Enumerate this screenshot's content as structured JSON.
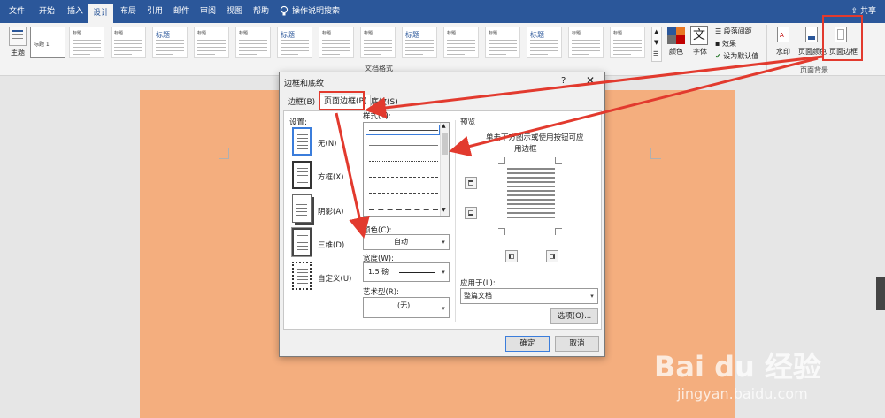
{
  "tabs": [
    "文件",
    "开始",
    "插入",
    "设计",
    "布局",
    "引用",
    "邮件",
    "审阅",
    "视图",
    "帮助"
  ],
  "active_tab": "设计",
  "search": {
    "label": "操作说明搜索"
  },
  "share": {
    "label": "共享"
  },
  "ribbon": {
    "theme": {
      "label": "主题"
    },
    "style_gallery": [
      "标题 1",
      "标题",
      "标题",
      "标题",
      "标题",
      "标题",
      "标题",
      "标题",
      "标题",
      "标题",
      "标题",
      "标题",
      "标题",
      "标题",
      "标题"
    ],
    "doc_format_label": "文档格式",
    "colors_label": "颜色",
    "fonts_label": "字体",
    "para_spacing_label": "段落间距",
    "effects_label": "效果",
    "set_default_label": "设为默认值",
    "watermark_label": "水印",
    "page_color_label": "页面颜色",
    "page_borders_label": "页面边框",
    "page_background_label": "页面背景"
  },
  "dialog": {
    "title": "边框和底纹",
    "help": "?",
    "close": "✕",
    "tabs": [
      "边框(B)",
      "页面边框(P)",
      "底纹(S)"
    ],
    "active_tab": "页面边框(P)",
    "settings_label": "设置:",
    "settings": [
      "无(N)",
      "方框(X)",
      "阴影(A)",
      "三维(D)",
      "自定义(U)"
    ],
    "style_label": "样式(Y):",
    "color_label": "颜色(C):",
    "color_value": "自动",
    "width_label": "宽度(W):",
    "width_value": "1.5 磅",
    "art_label": "艺术型(R):",
    "art_value": "(无)",
    "preview_label": "预览",
    "preview_hint_1": "单击下方图示或使用按钮可应",
    "preview_hint_2": "用边框",
    "apply_label": "应用于(L):",
    "apply_value": "整篇文档",
    "options_button": "选项(O)...",
    "ok_button": "确定",
    "cancel_button": "取消"
  },
  "watermark": {
    "big": "Bai du 经验",
    "small": "jingyan.baidu.com"
  },
  "colors": {
    "title_bar": "#2b579a",
    "page": "#f4ae7e",
    "highlight": "#e23a2e"
  }
}
